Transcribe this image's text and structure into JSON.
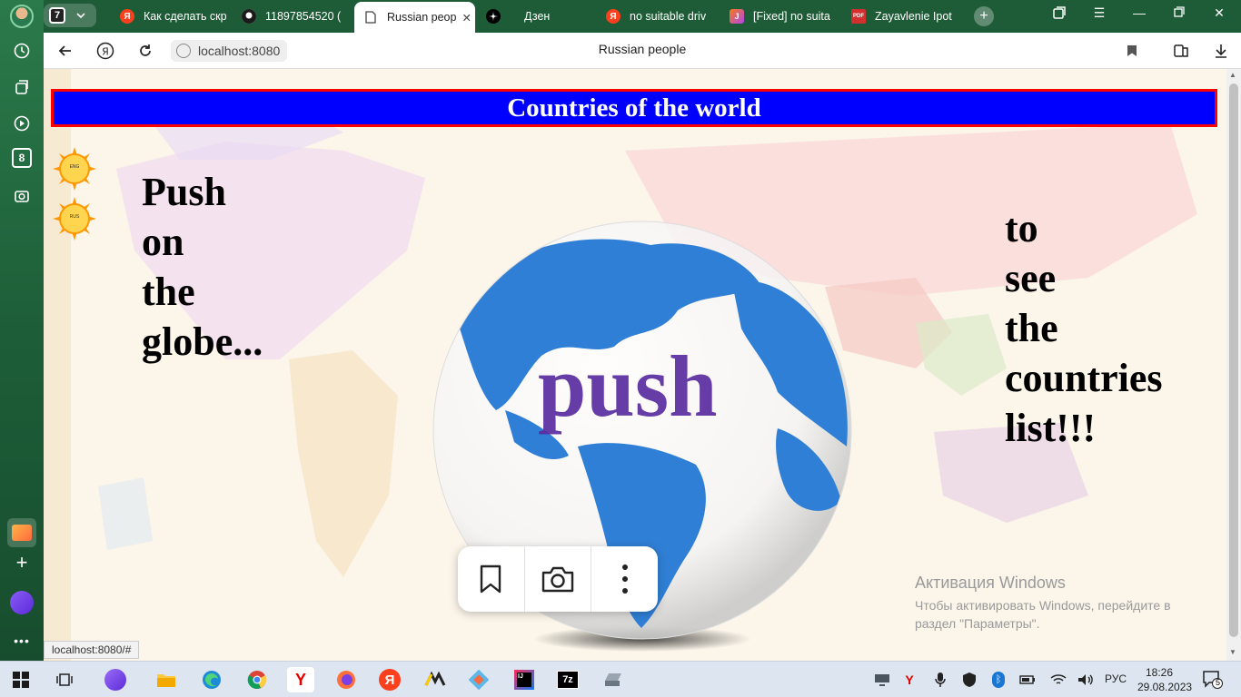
{
  "browser": {
    "tab_count": "7",
    "tabs": [
      {
        "label": "Как сделать скр",
        "icon": "yandex-icon"
      },
      {
        "label": "11897854520 (",
        "icon": "github-icon"
      },
      {
        "label": "Russian peop",
        "icon": "page-icon",
        "active": true
      },
      {
        "label": "Дзен",
        "icon": "dzen-icon"
      },
      {
        "label": "no suitable driv",
        "icon": "yandex-icon"
      },
      {
        "label": "[Fixed] no suita",
        "icon": "jetbrains-icon"
      },
      {
        "label": "Zayavlenie Ipot",
        "icon": "pdf-icon"
      }
    ],
    "url": "localhost:8080",
    "page_title": "Russian people",
    "status_url": "localhost:8080/#"
  },
  "page": {
    "header": "Countries of the world",
    "sun_buttons": [
      "ENG",
      "RUS"
    ],
    "left_text": [
      "Push",
      "on",
      "the",
      "globe..."
    ],
    "right_text": [
      "to",
      "see",
      "the",
      "countries",
      "list!!!"
    ],
    "globe_word": "push"
  },
  "watermark": {
    "title": "Активация Windows",
    "line1": "Чтобы активировать Windows, перейдите в",
    "line2": "раздел \"Параметры\"."
  },
  "taskbar": {
    "lang": "РУС",
    "time": "18:26",
    "date": "29.08.2023",
    "notifications": "5"
  },
  "colors": {
    "header_bg": "#0000ff",
    "header_border": "#ff0000",
    "globe_ocean": "#ffffff",
    "globe_land": "#2f7fd6",
    "push_text": "#5a2ca0",
    "browser_green": "#1e5b37"
  }
}
